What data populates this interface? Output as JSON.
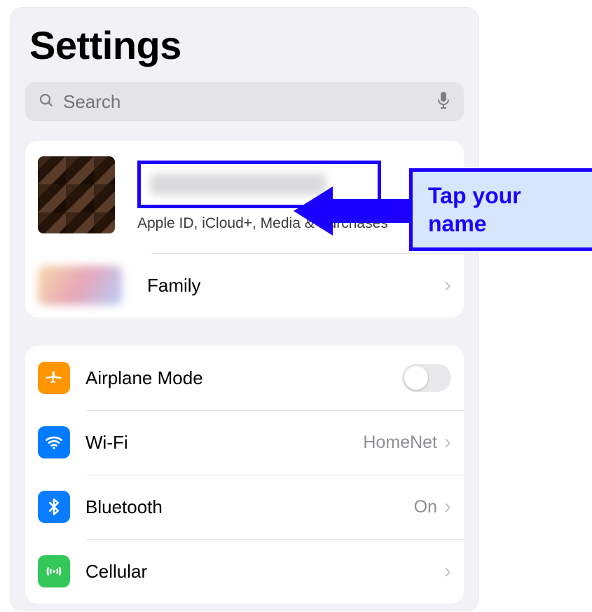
{
  "header": {
    "title": "Settings"
  },
  "search": {
    "placeholder": "Search"
  },
  "account": {
    "subtitle": "Apple ID, iCloud+, Media & Purchases",
    "family_label": "Family"
  },
  "callout": {
    "line1": "Tap your",
    "line2": "name"
  },
  "settings": {
    "airplane": {
      "label": "Airplane Mode"
    },
    "wifi": {
      "label": "Wi-Fi",
      "value": "HomeNet"
    },
    "bluetooth": {
      "label": "Bluetooth",
      "value": "On"
    },
    "cellular": {
      "label": "Cellular"
    }
  }
}
